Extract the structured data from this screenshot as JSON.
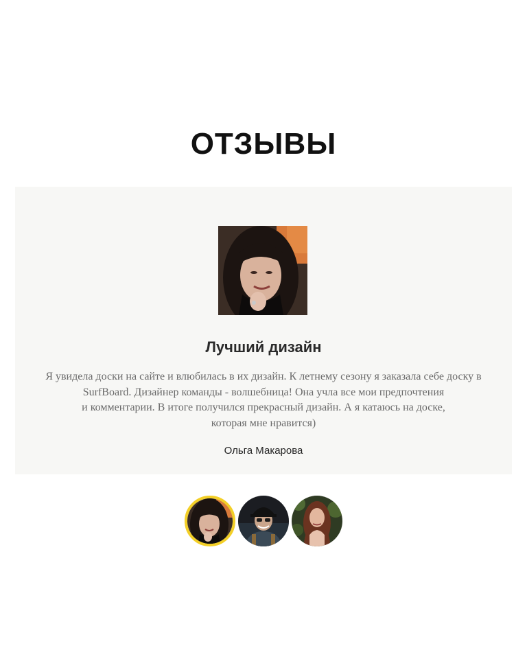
{
  "section": {
    "title": "ОТЗЫВЫ"
  },
  "review": {
    "title": "Лучший дизайн",
    "text_lines": [
      "Я увидела доски на сайте и влюбилась в их дизайн. К летнему сезону я заказала себе доску в",
      "SurfBoard. Дизайнер команды - волшебница! Она учла все мои предпочтения",
      "и комментарии. В итоге получился прекрасный дизайн. А я катаюсь на доске,",
      "которая мне нравится)"
    ],
    "author": "Ольга Макарова"
  },
  "colors": {
    "accent": "#f3cf27",
    "card_background": "#f7f7f5"
  },
  "reviewers": [
    {
      "active": true
    },
    {
      "active": false
    },
    {
      "active": false
    }
  ]
}
